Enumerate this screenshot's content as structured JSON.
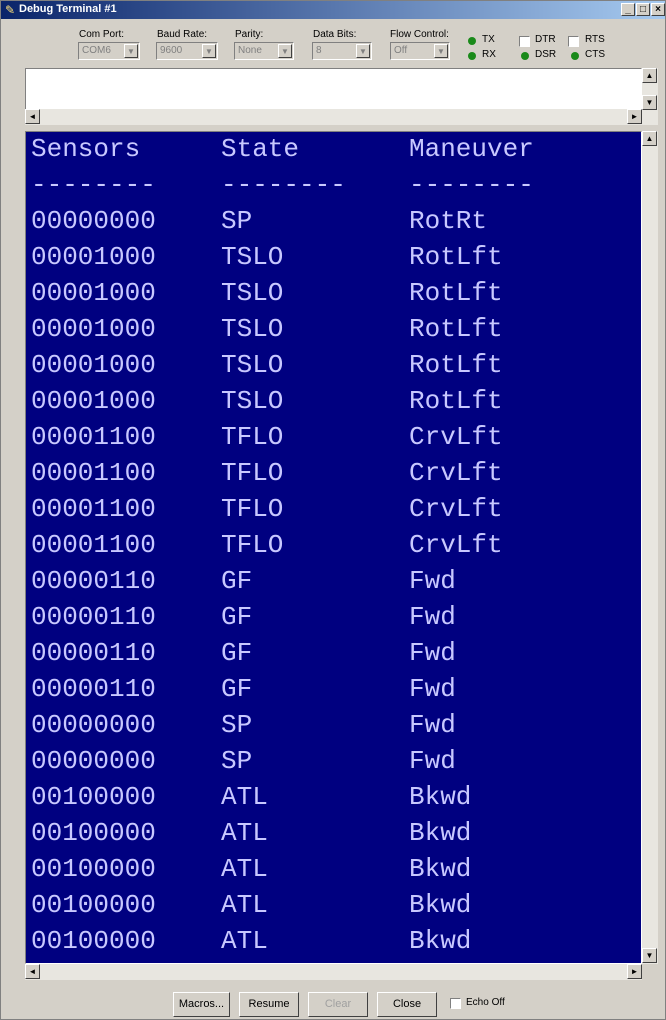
{
  "window": {
    "title": "Debug Terminal #1",
    "minimize": "_",
    "maximize": "□",
    "close": "×"
  },
  "settings": {
    "com_port": {
      "label": "Com Port:",
      "value": "COM6"
    },
    "baud_rate": {
      "label": "Baud Rate:",
      "value": "9600"
    },
    "parity": {
      "label": "Parity:",
      "value": "None"
    },
    "data_bits": {
      "label": "Data Bits:",
      "value": "8"
    },
    "flow_control": {
      "label": "Flow Control:",
      "value": "Off"
    }
  },
  "indicators": {
    "tx": "TX",
    "rx": "RX",
    "dtr": "DTR",
    "rts": "RTS",
    "dsr": "DSR",
    "cts": "CTS",
    "led_color": "#1a8a1a"
  },
  "receive": {
    "header": [
      "Sensors",
      "State",
      "Maneuver"
    ],
    "separator": [
      "--------",
      "--------",
      "--------"
    ],
    "rows": [
      [
        "00000000",
        "SP",
        "RotRt"
      ],
      [
        "00001000",
        "TSLO",
        "RotLft"
      ],
      [
        "00001000",
        "TSLO",
        "RotLft"
      ],
      [
        "00001000",
        "TSLO",
        "RotLft"
      ],
      [
        "00001000",
        "TSLO",
        "RotLft"
      ],
      [
        "00001000",
        "TSLO",
        "RotLft"
      ],
      [
        "00001100",
        "TFLO",
        "CrvLft"
      ],
      [
        "00001100",
        "TFLO",
        "CrvLft"
      ],
      [
        "00001100",
        "TFLO",
        "CrvLft"
      ],
      [
        "00001100",
        "TFLO",
        "CrvLft"
      ],
      [
        "00000110",
        "GF",
        "Fwd"
      ],
      [
        "00000110",
        "GF",
        "Fwd"
      ],
      [
        "00000110",
        "GF",
        "Fwd"
      ],
      [
        "00000110",
        "GF",
        "Fwd"
      ],
      [
        "00000000",
        "SP",
        "Fwd"
      ],
      [
        "00000000",
        "SP",
        "Fwd"
      ],
      [
        "00100000",
        "ATL",
        "Bkwd"
      ],
      [
        "00100000",
        "ATL",
        "Bkwd"
      ],
      [
        "00100000",
        "ATL",
        "Bkwd"
      ],
      [
        "00100000",
        "ATL",
        "Bkwd"
      ],
      [
        "00100000",
        "ATL",
        "Bkwd"
      ]
    ],
    "background": "#000080",
    "text_color": "#c8c8ff"
  },
  "buttons": {
    "macros": "Macros...",
    "resume": "Resume",
    "clear": "Clear",
    "close": "Close",
    "echo_off": "Echo Off"
  }
}
